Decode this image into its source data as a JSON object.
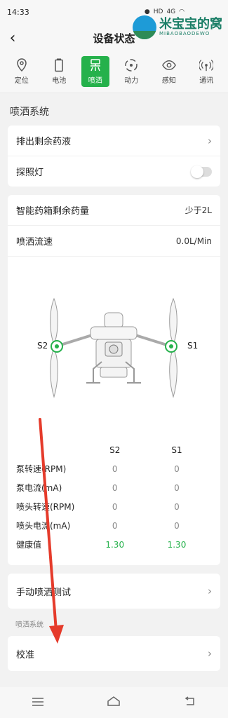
{
  "status": {
    "time": "14:33",
    "network": "4G",
    "hd": "HD"
  },
  "nav": {
    "title": "设备状态"
  },
  "watermark": {
    "main": "米宝宝的窝",
    "sub": "MIBAOBAODEWO"
  },
  "tabs": [
    {
      "label": "定位",
      "icon": "location-pin-icon"
    },
    {
      "label": "电池",
      "icon": "battery-icon"
    },
    {
      "label": "喷洒",
      "icon": "spray-icon",
      "active": true
    },
    {
      "label": "动力",
      "icon": "propulsion-icon"
    },
    {
      "label": "感知",
      "icon": "eye-icon"
    },
    {
      "label": "通讯",
      "icon": "signal-icon"
    }
  ],
  "spray": {
    "section_title": "喷洒系统",
    "drain_label": "排出剩余药液",
    "light_label": "探照灯",
    "tank_label": "智能药箱剩余药量",
    "tank_value": "少于2L",
    "flow_label": "喷洒流速",
    "flow_value": "0.0L/Min",
    "s1": "S1",
    "s2": "S2"
  },
  "metrics": {
    "headers": [
      "S2",
      "S1"
    ],
    "rows": [
      {
        "label": "泵转速(RPM)",
        "s2": "0",
        "s1": "0"
      },
      {
        "label": "泵电流(mA)",
        "s2": "0",
        "s1": "0"
      },
      {
        "label": "喷头转速(RPM)",
        "s2": "0",
        "s1": "0"
      },
      {
        "label": "喷头电流(mA)",
        "s2": "0",
        "s1": "0"
      },
      {
        "label": "健康值",
        "s2": "1.30",
        "s1": "1.30"
      }
    ]
  },
  "manual_test": {
    "label": "手动喷洒测试"
  },
  "calib_section": {
    "title": "喷洒系统"
  },
  "calibrate": {
    "label": "校准"
  },
  "colors": {
    "accent": "#25b14b",
    "annotation_arrow": "#e53b2b"
  }
}
